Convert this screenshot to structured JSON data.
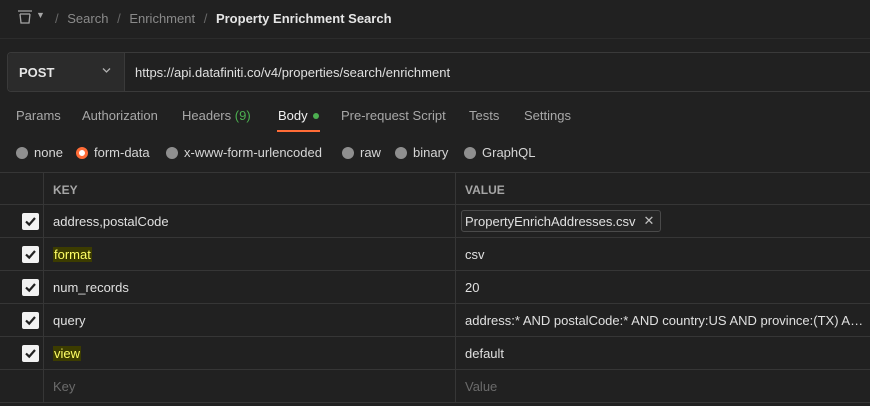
{
  "breadcrumb": {
    "items": [
      "Search",
      "Enrichment"
    ],
    "current": "Property Enrichment Search"
  },
  "request": {
    "method": "POST",
    "url": "https://api.datafiniti.co/v4/properties/search/enrichment"
  },
  "tabs": {
    "params": "Params",
    "authorization": "Authorization",
    "headers": "Headers",
    "headers_count": "(9)",
    "body": "Body",
    "prerequest": "Pre-request Script",
    "tests": "Tests",
    "settings": "Settings"
  },
  "body_types": {
    "none": "none",
    "form_data": "form-data",
    "urlencoded": "x-www-form-urlencoded",
    "raw": "raw",
    "binary": "binary",
    "graphql": "GraphQL",
    "selected": "form-data"
  },
  "table": {
    "key_header": "KEY",
    "value_header": "VALUE",
    "rows": [
      {
        "key": "address,postalCode",
        "value": "PropertyEnrichAddresses.csv",
        "checked": true
      },
      {
        "key": "format",
        "value": "csv",
        "checked": true
      },
      {
        "key": "num_records",
        "value": "20",
        "checked": true
      },
      {
        "key": "query",
        "value": "address:* AND postalCode:* AND country:US AND province:(TX) AN...",
        "checked": true
      },
      {
        "key": "view",
        "value": "default",
        "checked": true
      }
    ],
    "new_row": {
      "key_placeholder": "Key",
      "value_placeholder": "Value"
    }
  },
  "colors": {
    "accent": "#ff6c37",
    "success": "#4caf50",
    "highlight": "#ffff66"
  },
  "icons": [
    "collection-icon",
    "caret-down-icon",
    "chevron-down-icon",
    "checkbox-checked-icon",
    "close-icon"
  ]
}
